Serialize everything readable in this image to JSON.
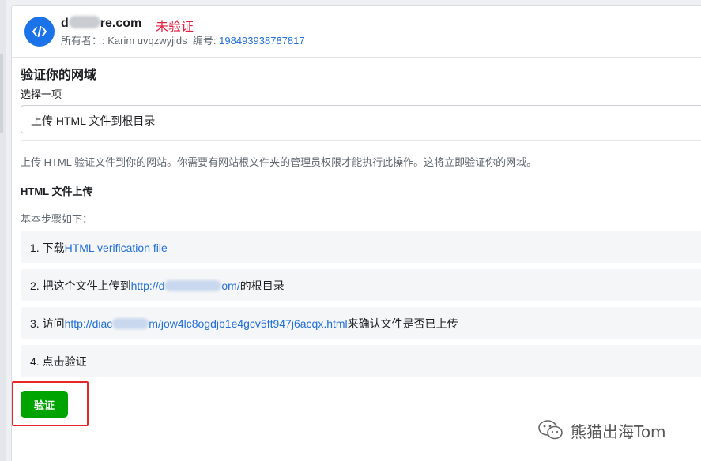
{
  "header": {
    "domain_prefix": "d",
    "domain_suffix": "re.com",
    "status": "未验证",
    "owner_label": "所有者：",
    "owner_value": ": Karim uvqzwyjids",
    "id_label": "编号:",
    "id_value": "198493938787817"
  },
  "verify": {
    "title": "验证你的网域",
    "select_label": "选择一项",
    "select_value": "上传 HTML 文件到根目录",
    "description": "上传 HTML 验证文件到你的网站。你需要有网站根文件夹的管理员权限才能执行此操作。这将立即验证你的网域。",
    "subtitle": "HTML 文件上传",
    "steps_intro": "基本步骤如下：",
    "steps": [
      {
        "prefix": "1. 下载",
        "link": "HTML verification file",
        "suffix": ""
      },
      {
        "prefix": "2. 把这个文件上传到",
        "link_start": "http://d",
        "link_end": "om/",
        "suffix": "的根目录"
      },
      {
        "prefix": "3. 访问",
        "link_start": "http://diac",
        "link_end": "m/jow4lc8ogdjb1e4gcv5ft947j6acqx.html",
        "suffix": "来确认文件是否已上传"
      },
      {
        "prefix": "4. 点击验证"
      }
    ],
    "button_label": "验证"
  },
  "watermark": {
    "text": "熊猫出海Tom"
  },
  "colors": {
    "accent": "#1a73e8",
    "status_red": "#e41e3f",
    "link": "#216fdb",
    "button_green": "#00a400",
    "highlight_red": "#e8262a"
  }
}
